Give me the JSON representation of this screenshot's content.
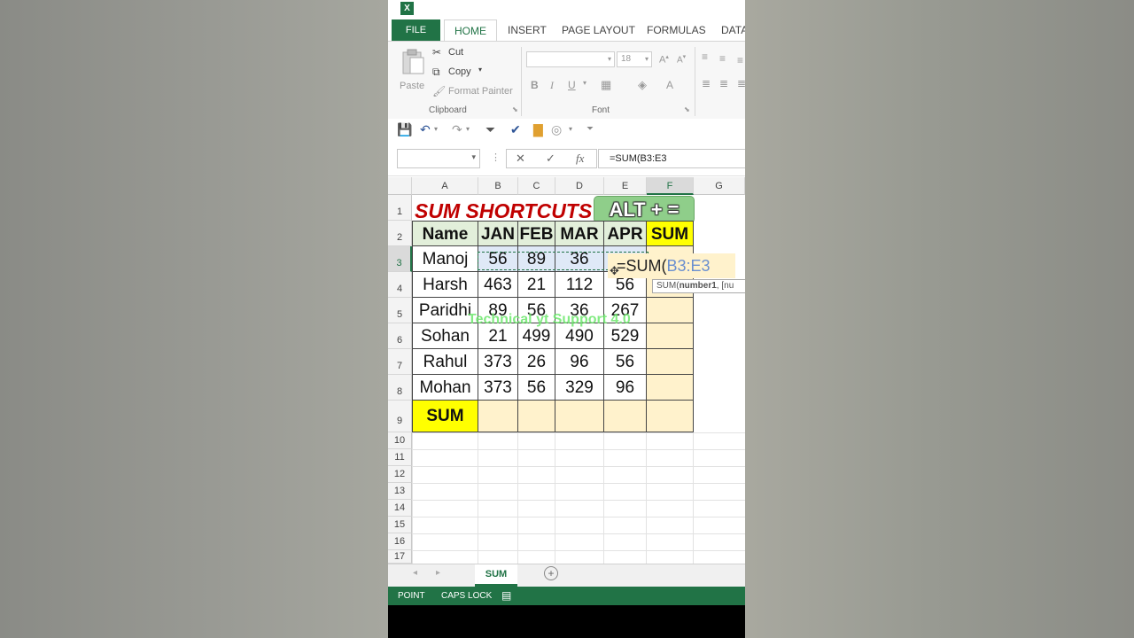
{
  "ribbon": {
    "tabs": [
      "FILE",
      "HOME",
      "INSERT",
      "PAGE LAYOUT",
      "FORMULAS",
      "DATA"
    ],
    "clipboard": {
      "paste": "Paste",
      "cut": "Cut",
      "copy": "Copy",
      "format_painter": "Format Painter",
      "group_label": "Clipboard"
    },
    "font": {
      "font_size": "18",
      "bold": "B",
      "italic": "I",
      "underline": "U",
      "group_label": "Font"
    }
  },
  "formula_bar": {
    "name_box": "",
    "formula": "=SUM(B3:E3"
  },
  "grid": {
    "columns": [
      "A",
      "B",
      "C",
      "D",
      "E",
      "F",
      "G"
    ],
    "rows": [
      "1",
      "2",
      "3",
      "4",
      "5",
      "6",
      "7",
      "8",
      "9",
      "10",
      "11",
      "12",
      "13",
      "14",
      "15",
      "16",
      "17"
    ],
    "title": "SUM SHORTCUTS",
    "shortcut": "ALT + =",
    "headers": [
      "Name",
      "JAN",
      "FEB",
      "MAR",
      "APR",
      "SUM"
    ],
    "data": [
      [
        "Manoj",
        "56",
        "89",
        "36",
        ""
      ],
      [
        "Harsh",
        "463",
        "21",
        "112",
        "56"
      ],
      [
        "Paridhi",
        "89",
        "56",
        "36",
        "267"
      ],
      [
        "Sohan",
        "21",
        "499",
        "490",
        "529"
      ],
      [
        "Rahul",
        "373",
        "26",
        "96",
        "56"
      ],
      [
        "Mohan",
        "373",
        "56",
        "329",
        "96"
      ]
    ],
    "sum_label": "SUM",
    "editor_prefix": "=SUM(",
    "editor_ref": "B3:E3",
    "tooltip_fn": "SUM(",
    "tooltip_arg": "number1",
    "tooltip_rest": ", [nu",
    "watermark": "Technical yt Support 4.0"
  },
  "sheet_tab": "SUM",
  "status": {
    "mode": "POINT",
    "caps": "CAPS LOCK"
  },
  "colors": {
    "excel_green": "#217346",
    "header_fill": "#e2efda",
    "yellow": "#ffff00",
    "peach": "#fff2cc",
    "title_red": "#c00000"
  }
}
